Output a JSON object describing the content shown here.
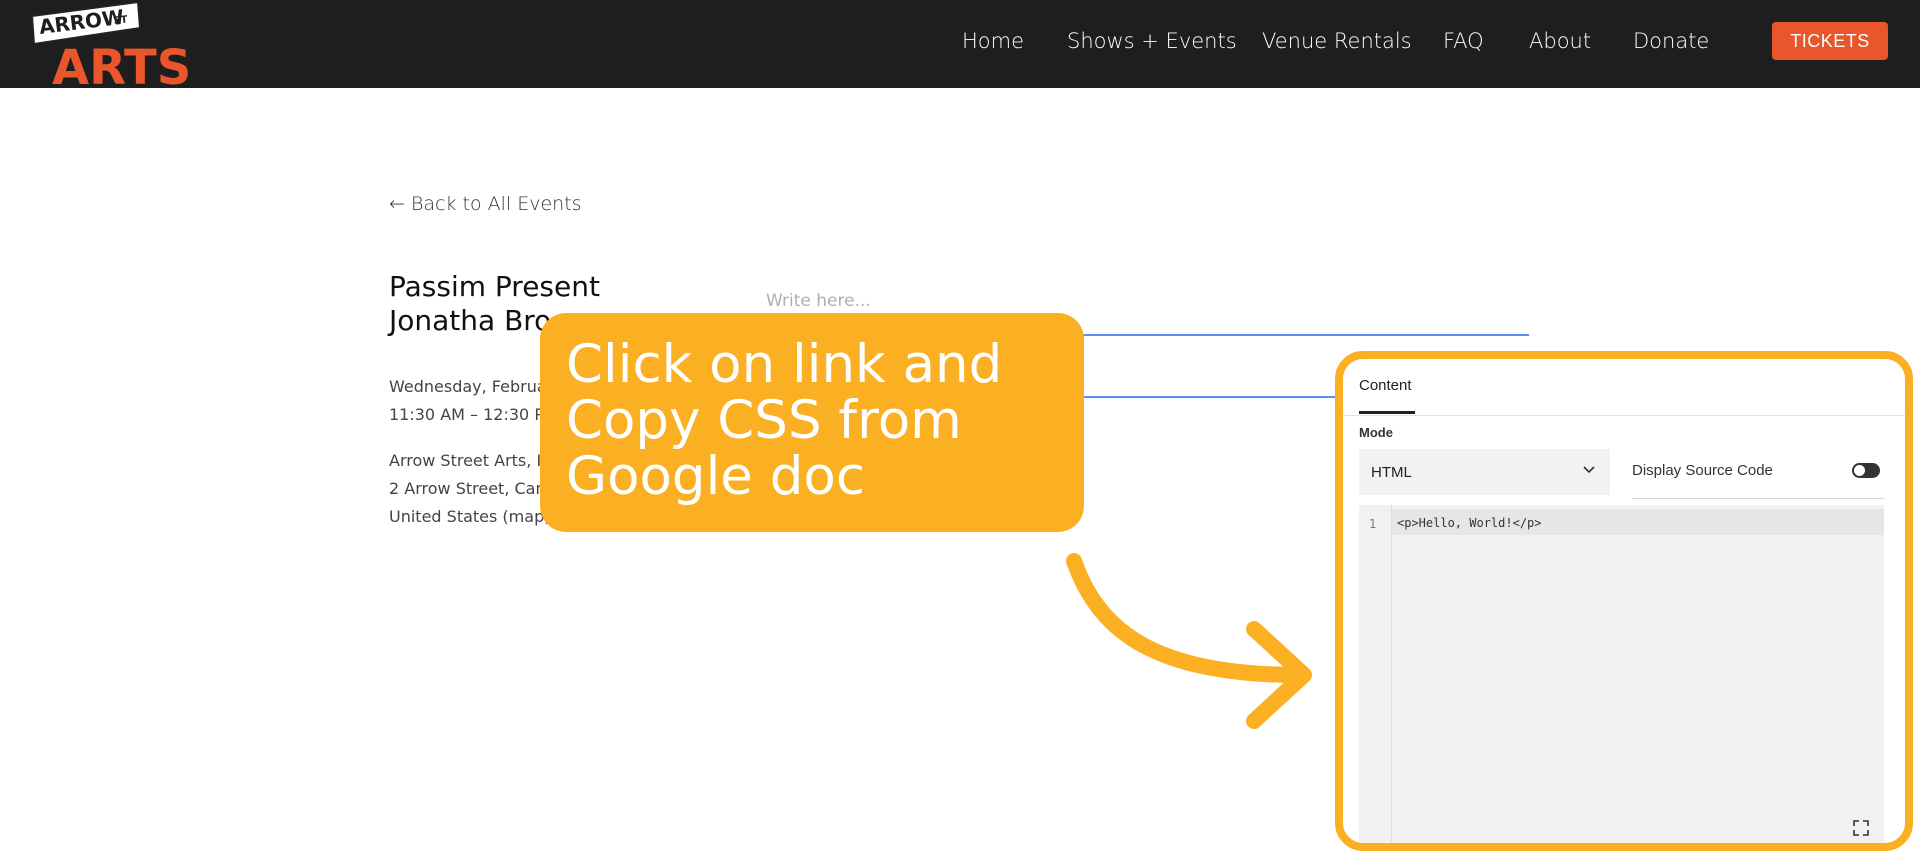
{
  "header": {
    "logo": {
      "line1": "ARROW",
      "superscript": "ST",
      "line2": "ARTS"
    },
    "nav": [
      "Home",
      "Shows + Events",
      "Venue Rentals",
      "FAQ",
      "About",
      "Donate"
    ],
    "tickets_label": "TICKETS",
    "colors": {
      "bar": "#1e1e1e",
      "accent": "#e9562b"
    }
  },
  "main": {
    "back_link": "← Back to All Events",
    "title_line1": "Passim Present",
    "title_line2": "Jonatha Bro",
    "date_line": "Wednesday, Februa",
    "time_line": "11:30 AM – 12:30 PM",
    "addr1": "Arrow Street Arts, In",
    "addr2": "2 Arrow Street, Cam",
    "addr3": "United States (map)",
    "editor_placeholder": "Write here..."
  },
  "tooltip": {
    "line1": "Click on link and",
    "line2": "Copy CSS from",
    "line3": "Google doc",
    "color": "#fbb024"
  },
  "panel": {
    "tab": "Content",
    "mode_label": "Mode",
    "mode_value": "HTML",
    "toggle_label": "Display Source Code",
    "line_number": "1",
    "code": "<p>Hello, World!</p>",
    "icons": [
      "chevron-down-icon",
      "expand-icon"
    ]
  }
}
